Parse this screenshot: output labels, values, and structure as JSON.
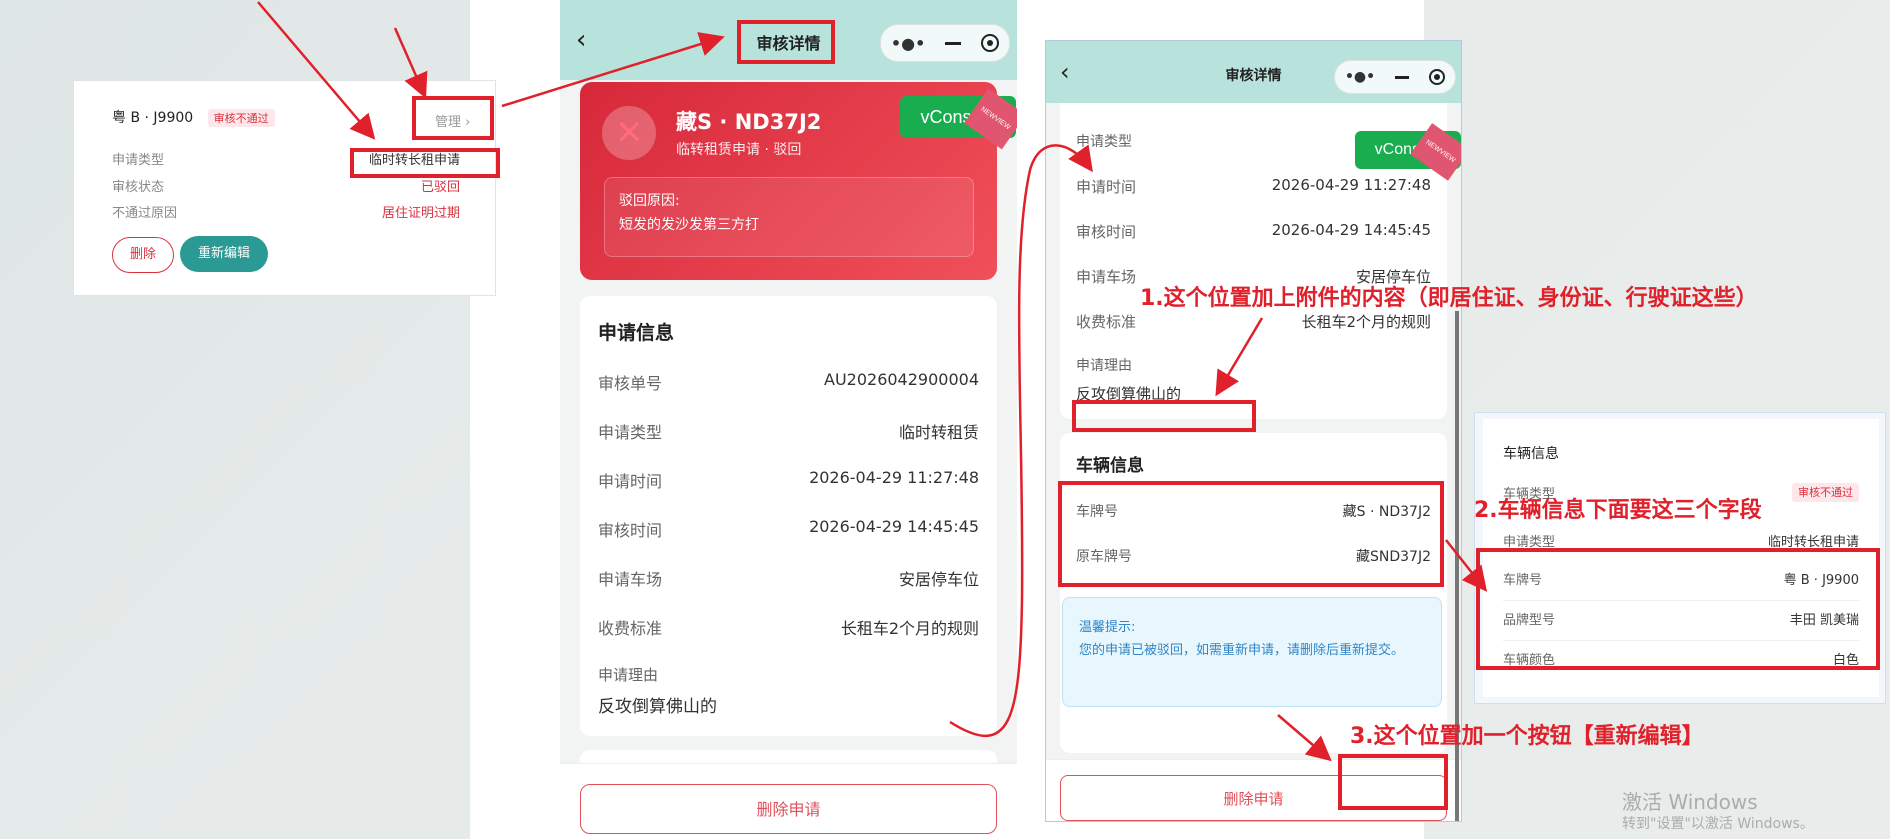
{
  "card1": {
    "plate": "粤 B · J9900",
    "status_tag": "审核不通过",
    "manage_label": "管理 ›",
    "rows": [
      {
        "label": "申请类型",
        "value": "临时转长租申请"
      },
      {
        "label": "审核状态",
        "value": "已驳回"
      },
      {
        "label": "不通过原因",
        "value": "居住证明过期"
      }
    ],
    "delete_label": "删除",
    "reedit_label": "重新编辑"
  },
  "phone1": {
    "title": "审核详情",
    "plate": "藏S · ND37J2",
    "subtitle": "临转租赁申请 · 驳回",
    "reject_title": "驳回原因:",
    "reject_text": "短发的发沙发第三方打",
    "vconsole": "vConsole",
    "vconsole_ribbon": "NEWVIEW",
    "section_title": "申请信息",
    "rows": [
      {
        "label": "审核单号",
        "value": "AU2026042900004"
      },
      {
        "label": "申请类型",
        "value": "临时转租赁"
      },
      {
        "label": "申请时间",
        "value": "2026-04-29 11:27:48"
      },
      {
        "label": "审核时间",
        "value": "2026-04-29 14:45:45"
      },
      {
        "label": "申请车场",
        "value": "安居停车位"
      },
      {
        "label": "收费标准",
        "value": "长租车2个月的规则"
      }
    ],
    "reason_label": "申请理由",
    "reason_value": "反攻倒算佛山的",
    "delete_button": "删除申请"
  },
  "phone2": {
    "title": "审核详情",
    "vconsole": "vConsole",
    "vconsole_ribbon": "NEWVIEW",
    "type_label": "申请类型",
    "rows": [
      {
        "label": "申请时间",
        "value": "2026-04-29 11:27:48"
      },
      {
        "label": "审核时间",
        "value": "2026-04-29 14:45:45"
      },
      {
        "label": "申请车场",
        "value": "安居停车位"
      },
      {
        "label": "收费标准",
        "value": "长租车2个月的规则"
      }
    ],
    "reason_label": "申请理由",
    "reason_value": "反攻倒算佛山的",
    "vehicle_title": "车辆信息",
    "vehicle_rows": [
      {
        "label": "车牌号",
        "value": "藏S · ND37J2"
      },
      {
        "label": "原车牌号",
        "value": "藏SND37J2"
      }
    ],
    "tip_title": "温馨提示:",
    "tip_text": "您的申请已被驳回，如需重新申请，请删除后重新提交。",
    "delete_button": "删除申请"
  },
  "mini_card": {
    "title": "车辆信息",
    "rows": [
      {
        "label": "车辆类型",
        "value": "审核不通过"
      },
      {
        "label": "申请类型",
        "value": "临时转长租申请"
      },
      {
        "label": "车牌号",
        "value": "粤 B · J9900"
      },
      {
        "label": "品牌型号",
        "value": "丰田 凯美瑞"
      },
      {
        "label": "车辆颜色",
        "value": "白色"
      }
    ]
  },
  "annotations": {
    "a1": "1.这个位置加上附件的内容（即居住证、身份证、行驶证这些）",
    "a2": "2.车辆信息下面要这三个字段",
    "a3": "3.这个位置加一个按钮【重新编辑】"
  },
  "watermark": {
    "line1": "激活 Windows",
    "line2": "转到\"设置\"以激活 Windows。"
  },
  "colors": {
    "accent": "#2c9a94",
    "danger": "#e0202a",
    "nav": "#b7e3dc",
    "vconsole": "#1aad4f"
  }
}
